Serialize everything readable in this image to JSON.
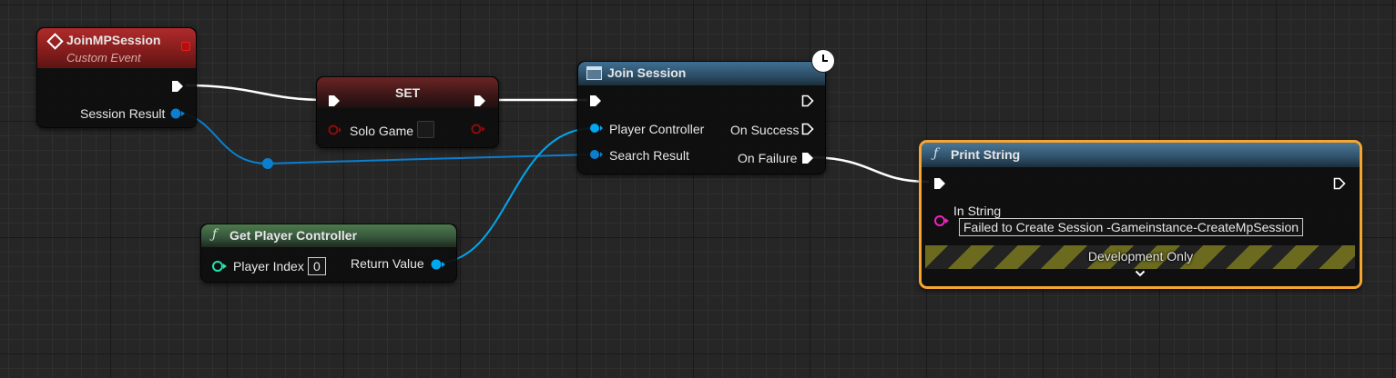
{
  "colors": {
    "exec_wire": "#ffffff",
    "struct_wire": "#0a7fd0",
    "object_wire": "#00a8f0",
    "bool_pin": "#8e0b0b",
    "string_pin": "#f020c0",
    "event_header": "#8c1f1f",
    "function_header": "#2d6ba0",
    "pure_header": "#3f6e3f",
    "selection": "#f7a531"
  },
  "nodes": {
    "join_mp_session": {
      "title": "JoinMPSession",
      "subtitle": "Custom Event",
      "pin_session_result": "Session Result",
      "icon": "event-diamond-icon"
    },
    "set": {
      "title": "SET",
      "pin_solo_game": "Solo Game"
    },
    "join_session": {
      "title": "Join Session",
      "pin_player_controller": "Player Controller",
      "pin_search_result": "Search Result",
      "pin_on_success": "On Success",
      "pin_on_failure": "On Failure",
      "icon": "latent-clock-icon"
    },
    "get_player_controller": {
      "title": "Get Player Controller",
      "pin_player_index": "Player Index",
      "player_index_value": "0",
      "pin_return_value": "Return Value"
    },
    "print_string": {
      "title": "Print String",
      "pin_in_string": "In String",
      "in_string_value": "Failed to Create Session -Gameinstance-CreateMpSession",
      "dev_only_label": "Development Only"
    }
  }
}
